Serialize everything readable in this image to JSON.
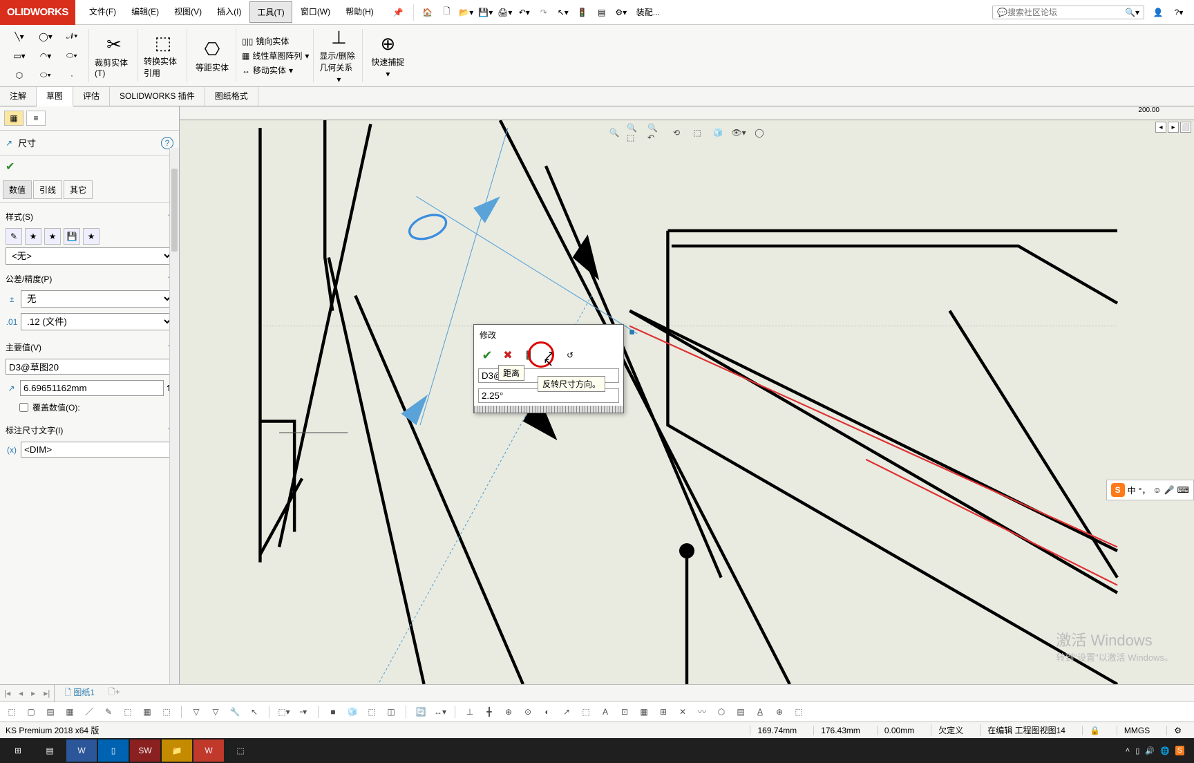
{
  "menubar": {
    "logo": "OLIDWORKS",
    "items": [
      "文件(F)",
      "编辑(E)",
      "视图(V)",
      "插入(I)",
      "工具(T)",
      "窗口(W)",
      "帮助(H)"
    ],
    "active_index": 4,
    "qat": {
      "assembly_label": "装配..."
    },
    "search_placeholder": "搜索社区论坛"
  },
  "ribbon": {
    "big1": "裁剪实体(T)",
    "big2": "转换实体引用",
    "big3": "等距实体",
    "g4": {
      "a": "镜向实体",
      "b": "线性草图阵列",
      "c": "移动实体"
    },
    "big5": "显示/删除几何关系",
    "big6": "快速捕捉"
  },
  "tabs": {
    "items": [
      "注解",
      "草图",
      "评估",
      "SOLIDWORKS 插件",
      "图纸格式"
    ],
    "active_index": 1
  },
  "ruler": {
    "mark": "200.00"
  },
  "leftpanel": {
    "config_title": "尺寸",
    "subtabs": [
      "数值",
      "引线",
      "其它"
    ],
    "subtab_active": 0,
    "style_hdr": "样式(S)",
    "style_select": "<无>",
    "tol_hdr": "公差/精度(P)",
    "tol_select1": "无",
    "tol_select2": ".12 (文件)",
    "mainval_hdr": "主要值(V)",
    "mainval_name": "D3@草图20",
    "mainval_val": "6.69651162mm",
    "override_label": "覆盖数值(O):",
    "dimtext_hdr": "标注尺寸文字(I)",
    "dimtext_val": "<DIM>"
  },
  "modify": {
    "title": "修改",
    "field1": "D3@I",
    "tooltip1": "距离",
    "tooltip2": "反转尺寸方向。",
    "value": "2.25°"
  },
  "ime": {
    "lang": "中"
  },
  "sheettabs": {
    "sheet1": "图纸1"
  },
  "statusbar": {
    "edition": "KS Premium 2018 x64 版",
    "coord1": "169.74mm",
    "coord2": "176.43mm",
    "coord3": "0.00mm",
    "state": "欠定义",
    "context": "在编辑 工程图视图14",
    "units": "MMGS"
  },
  "watermark": {
    "line1": "激活 Windows",
    "line2": "转到\"设置\"以激活 Windows。"
  }
}
